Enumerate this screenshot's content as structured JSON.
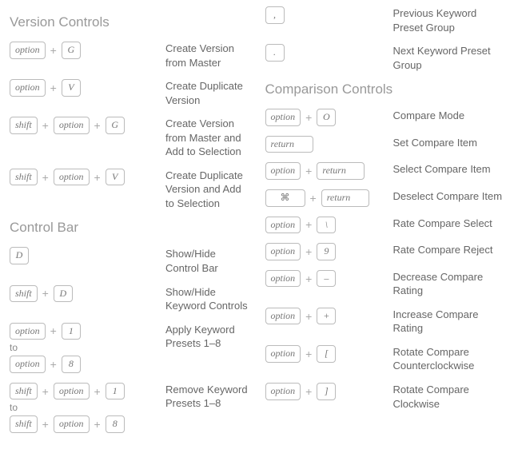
{
  "sections": {
    "version_controls": {
      "title": "Version Controls",
      "items": [
        {
          "keys": [
            "option",
            "G"
          ],
          "desc": "Create Version from Master"
        },
        {
          "keys": [
            "option",
            "V"
          ],
          "desc": "Create Duplicate Version"
        },
        {
          "keys": [
            "shift",
            "option",
            "G"
          ],
          "desc": "Create Version from Master and Add to Selection"
        },
        {
          "keys": [
            "shift",
            "option",
            "V"
          ],
          "desc": "Create Duplicate Version and Add to Selection"
        }
      ]
    },
    "control_bar": {
      "title": "Control Bar",
      "items": [
        {
          "keys": [
            "D"
          ],
          "desc": "Show/Hide Control Bar"
        },
        {
          "keys": [
            "shift",
            "D"
          ],
          "desc": "Show/Hide Keyword Controls"
        }
      ],
      "range1": {
        "from": [
          "option",
          "1"
        ],
        "to_label": "to",
        "to": [
          "option",
          "8"
        ],
        "desc": "Apply Keyword Presets 1–8"
      },
      "range2": {
        "from": [
          "shift",
          "option",
          "1"
        ],
        "to_label": "to",
        "to": [
          "shift",
          "option",
          "8"
        ],
        "desc": "Remove Keyword Presets 1–8"
      }
    },
    "preset_nav": {
      "items": [
        {
          "key": ",",
          "desc": "Previous Keyword Preset Group"
        },
        {
          "key": ".",
          "desc": "Next Keyword Preset Group"
        }
      ]
    },
    "comparison_controls": {
      "title": "Comparison Controls",
      "items": [
        {
          "keys": [
            "option",
            "O"
          ],
          "desc": "Compare Mode"
        },
        {
          "keys": [
            "return"
          ],
          "desc": "Set Compare Item"
        },
        {
          "keys": [
            "option",
            "return"
          ],
          "desc": "Select Compare Item"
        },
        {
          "keys": [
            "⌘",
            "return"
          ],
          "cmd": true,
          "desc": "Deselect Compare Item"
        },
        {
          "keys": [
            "option",
            "\\"
          ],
          "desc": "Rate Compare Select"
        },
        {
          "keys": [
            "option",
            "9"
          ],
          "desc": "Rate Compare Reject"
        },
        {
          "keys": [
            "option",
            "–"
          ],
          "desc": "Decrease Compare Rating"
        },
        {
          "keys": [
            "option",
            "+"
          ],
          "desc": "Increase Compare Rating"
        },
        {
          "keys": [
            "option",
            "["
          ],
          "desc": "Rotate Compare Counterclockwise"
        },
        {
          "keys": [
            "option",
            "]"
          ],
          "desc": "Rotate Compare Clockwise"
        }
      ]
    }
  }
}
